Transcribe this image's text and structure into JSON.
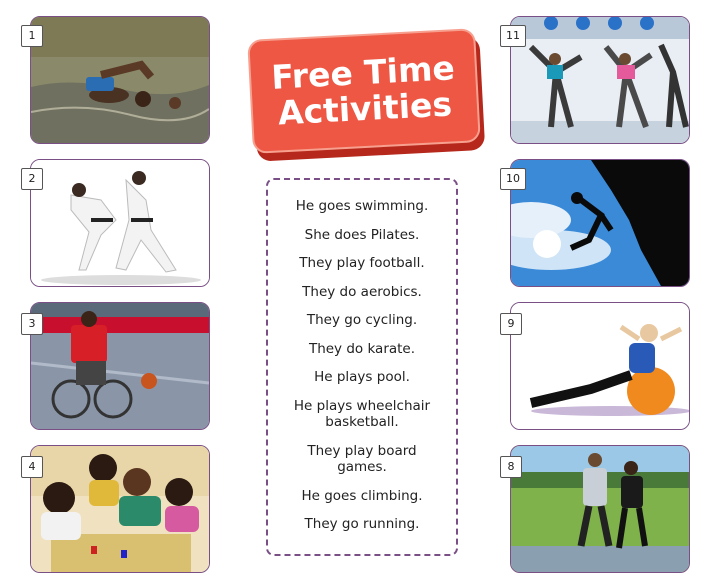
{
  "title": {
    "line1": "Free Time",
    "line2": "Activities"
  },
  "cards": {
    "n1": "1",
    "n2": "2",
    "n3": "3",
    "n4": "4",
    "n8": "8",
    "n9": "9",
    "n10": "10",
    "n11": "11"
  },
  "activities": [
    "He goes swimming.",
    "She does Pilates.",
    "They play football.",
    "They do aerobics.",
    "They go cycling.",
    "They do karate.",
    "He plays pool.",
    "He plays wheelchair basketball.",
    "They play board games.",
    "He goes climbing.",
    "They go running."
  ],
  "colors": {
    "border": "#7a4f86",
    "badge": "#ee5744",
    "badge_shadow": "#b5281b"
  }
}
